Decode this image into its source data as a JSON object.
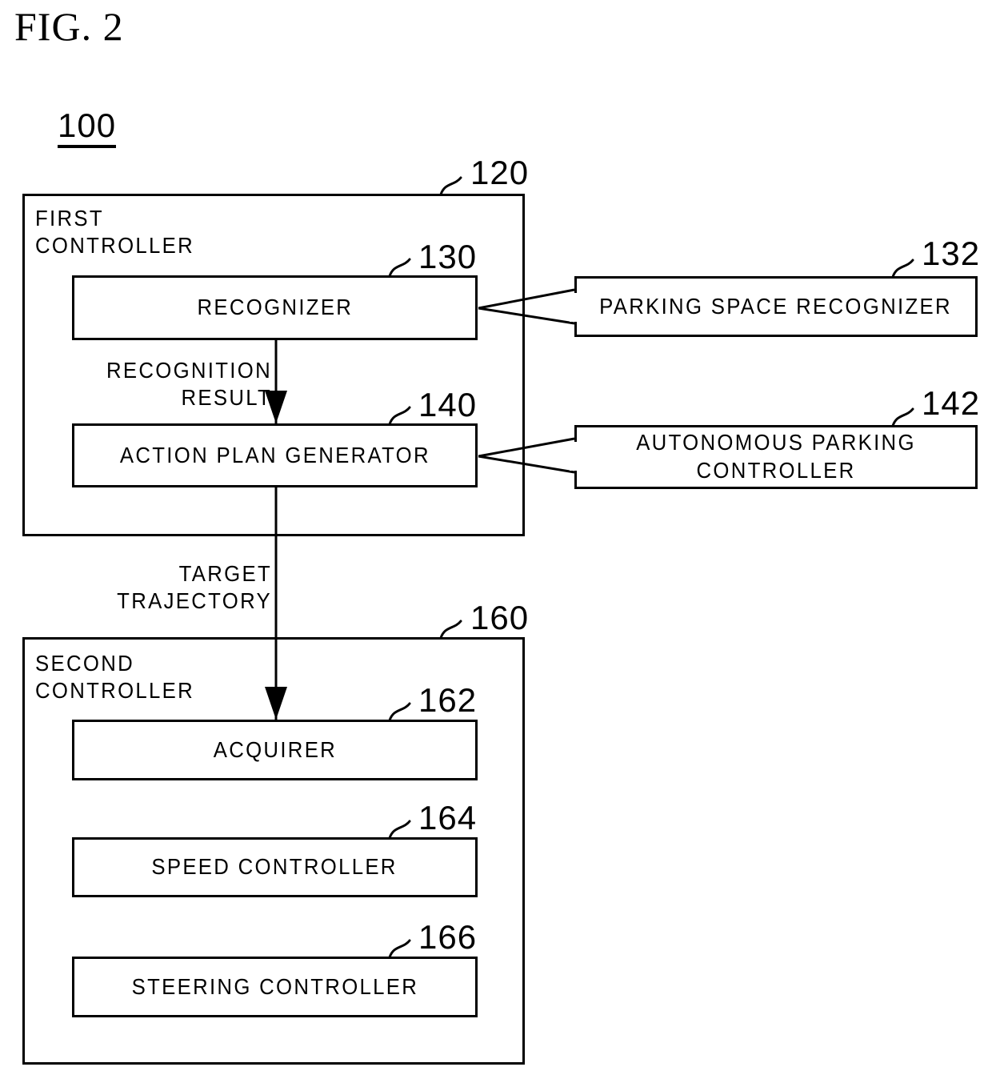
{
  "figure": {
    "title": "FIG. 2",
    "system_numeral": "100"
  },
  "diagram": {
    "type": "block-diagram",
    "containers": [
      {
        "id": "first-controller",
        "ref": "120",
        "title": "FIRST\nCONTROLLER"
      },
      {
        "id": "second-controller",
        "ref": "160",
        "title": "SECOND\nCONTROLLER"
      }
    ],
    "blocks": [
      {
        "id": "recognizer",
        "ref": "130",
        "label": "RECOGNIZER"
      },
      {
        "id": "action-plan-generator",
        "ref": "140",
        "label": "ACTION PLAN GENERATOR"
      },
      {
        "id": "parking-space-recognizer",
        "ref": "132",
        "label": "PARKING SPACE RECOGNIZER"
      },
      {
        "id": "autonomous-parking-controller",
        "ref": "142",
        "label": "AUTONOMOUS PARKING\nCONTROLLER"
      },
      {
        "id": "acquirer",
        "ref": "162",
        "label": "ACQUIRER"
      },
      {
        "id": "speed-controller",
        "ref": "164",
        "label": "SPEED CONTROLLER"
      },
      {
        "id": "steering-controller",
        "ref": "166",
        "label": "STEERING CONTROLLER"
      }
    ],
    "flow_labels": [
      {
        "id": "recognition-result",
        "text": "RECOGNITION\nRESULT"
      },
      {
        "id": "target-trajectory",
        "text": "TARGET\nTRAJECTORY"
      }
    ],
    "colors": {
      "line": "#000000",
      "background": "#ffffff"
    }
  }
}
